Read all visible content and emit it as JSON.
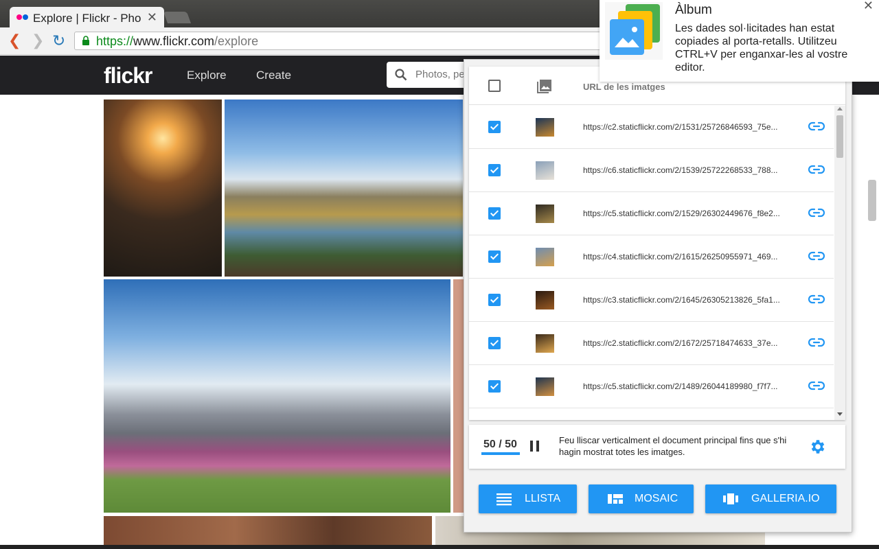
{
  "browser": {
    "tab_title": "Explore | Flickr - Pho",
    "tab_close": "✕",
    "url_scheme": "https://",
    "url_host": "www.flickr.com",
    "url_path": "/explore"
  },
  "flickr": {
    "logo": "flickr",
    "nav": {
      "explore": "Explore",
      "create": "Create"
    },
    "search_placeholder": "Photos, pe"
  },
  "extension": {
    "list_header": "URL de les imatges",
    "rows": [
      {
        "url": "https://c2.staticflickr.com/2/1531/25726846593_75e...",
        "checked": true
      },
      {
        "url": "https://c6.staticflickr.com/2/1539/25722268533_788...",
        "checked": true
      },
      {
        "url": "https://c5.staticflickr.com/2/1529/26302449676_f8e2...",
        "checked": true
      },
      {
        "url": "https://c4.staticflickr.com/2/1615/26250955971_469...",
        "checked": true
      },
      {
        "url": "https://c3.staticflickr.com/2/1645/26305213826_5fa1...",
        "checked": true
      },
      {
        "url": "https://c2.staticflickr.com/2/1672/25718474633_37e...",
        "checked": true
      },
      {
        "url": "https://c5.staticflickr.com/2/1489/26044189980_f7f7...",
        "checked": true
      }
    ],
    "progress_text": "50 / 50",
    "progress_fraction": 1.0,
    "status_message": "Feu lliscar verticalment el document principal fins que s'hi hagin mostrat totes les imatges.",
    "buttons": {
      "llista": "LLISTA",
      "mosaic": "MOSAIC",
      "galleria": "GALLERIA.IO"
    },
    "accent_color": "#2196f3"
  },
  "notification": {
    "title": "Àlbum",
    "body": "Les dades sol·licitades han estat copiades al porta-retalls. Utilitzeu CTRL+V per enganxar-les al vostre editor.",
    "close": "✕"
  },
  "icons": [
    "flickr-favicon-icon",
    "back-icon",
    "forward-icon",
    "reload-icon",
    "lock-icon",
    "search-icon",
    "image-icon",
    "link-icon",
    "pause-icon",
    "gear-icon",
    "list-icon",
    "mosaic-icon",
    "gallery-icon",
    "album-app-icon",
    "close-icon"
  ]
}
